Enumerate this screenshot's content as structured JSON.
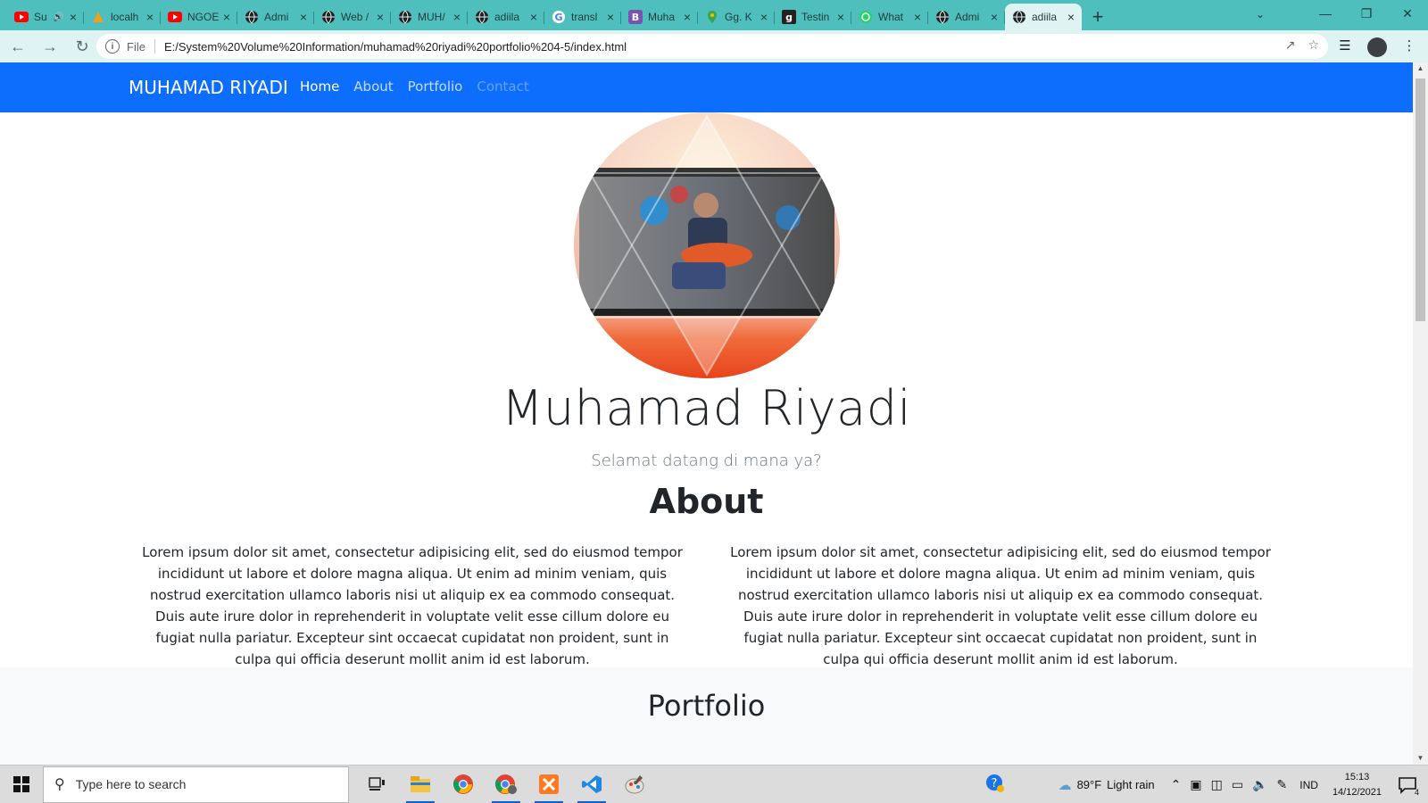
{
  "browser": {
    "tabs": [
      {
        "title": "Su",
        "favicon": "youtube-icon",
        "audio": true
      },
      {
        "title": "localh",
        "favicon": "xampp-icon"
      },
      {
        "title": "NGOE",
        "favicon": "youtube-icon"
      },
      {
        "title": "Admi",
        "favicon": "globe-icon"
      },
      {
        "title": "Web /",
        "favicon": "globe-icon"
      },
      {
        "title": "MUH/",
        "favicon": "globe-icon"
      },
      {
        "title": "adiila",
        "favicon": "globe-icon"
      },
      {
        "title": "transl",
        "favicon": "google-icon"
      },
      {
        "title": "Muha",
        "favicon": "bootstrap-icon"
      },
      {
        "title": "Gg. K",
        "favicon": "maps-icon"
      },
      {
        "title": "Testin",
        "favicon": "g-icon"
      },
      {
        "title": "What",
        "favicon": "whatsapp-icon"
      },
      {
        "title": "Admi",
        "favicon": "globe-icon"
      },
      {
        "title": "adiila",
        "favicon": "globe-icon",
        "active": true
      }
    ],
    "new_tab": "+",
    "address": {
      "scheme": "File",
      "url": "E:/System%20Volume%20Information/muhamad%20riyadi%20portfolio%204-5/index.html"
    },
    "accent": "#4fbfbe"
  },
  "page": {
    "navbar": {
      "brand": "MUHAMAD RIYADI",
      "links": [
        "Home",
        "About",
        "Portfolio",
        "Contact"
      ],
      "color": "#0d6efd"
    },
    "hero": {
      "name": "Muhamad Riyadi",
      "subtitle": "Selamat datang di mana ya?"
    },
    "about": {
      "title": "About",
      "col_left": "Lorem ipsum dolor sit amet, consectetur adipisicing elit, sed do eiusmod tempor incididunt ut labore et dolore magna aliqua. Ut enim ad minim veniam, quis nostrud exercitation ullamco laboris nisi ut aliquip ex ea commodo consequat. Duis aute irure dolor in reprehenderit in voluptate velit esse cillum dolore eu fugiat nulla pariatur. Excepteur sint occaecat cupidatat non proident, sunt in culpa qui officia deserunt mollit anim id est laborum.",
      "col_right": "Lorem ipsum dolor sit amet, consectetur adipisicing elit, sed do eiusmod tempor incididunt ut labore et dolore magna aliqua. Ut enim ad minim veniam, quis nostrud exercitation ullamco laboris nisi ut aliquip ex ea commodo consequat. Duis aute irure dolor in reprehenderit in voluptate velit esse cillum dolore eu fugiat nulla pariatur. Excepteur sint occaecat cupidatat non proident, sunt in culpa qui officia deserunt mollit anim id est laborum."
    },
    "portfolio": {
      "title": "Portfolio"
    }
  },
  "taskbar": {
    "search_placeholder": "Type here to search",
    "weather_temp": "89°F",
    "weather_text": "Light rain",
    "language": "IND",
    "time": "15:13",
    "date": "14/12/2021",
    "notification_count": "4"
  }
}
